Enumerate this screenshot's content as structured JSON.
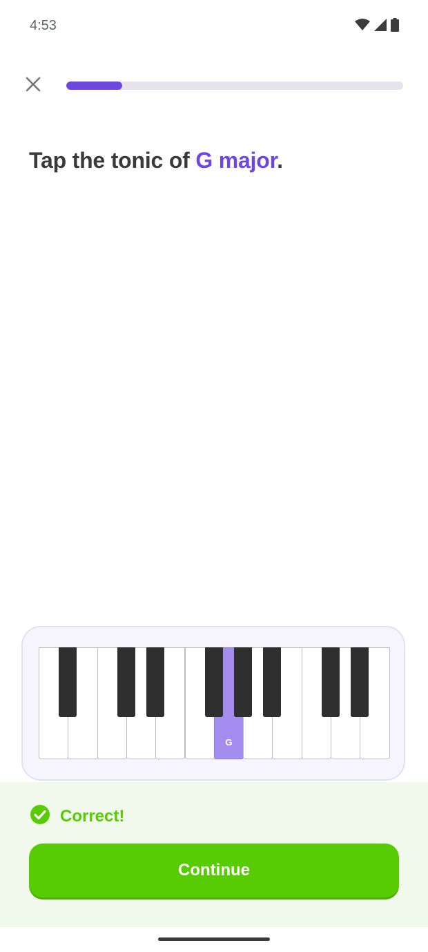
{
  "status_bar": {
    "time": "4:53",
    "icons": [
      "wifi-icon",
      "cell-signal-icon",
      "battery-icon"
    ]
  },
  "header": {
    "close_icon": "close-icon",
    "progress": 0.165
  },
  "question": {
    "prefix": "Tap the tonic of ",
    "highlight": "G major",
    "suffix": "."
  },
  "keyboard": {
    "white_keys": [
      {
        "label": "",
        "active": false
      },
      {
        "label": "",
        "active": false
      },
      {
        "label": "",
        "active": false
      },
      {
        "label": "",
        "active": false
      },
      {
        "label": "",
        "active": false
      },
      {
        "label": "",
        "active": false
      },
      {
        "label": "G",
        "active": true
      },
      {
        "label": "",
        "active": false
      },
      {
        "label": "",
        "active": false
      },
      {
        "label": "",
        "active": false
      },
      {
        "label": "",
        "active": false
      },
      {
        "label": "",
        "active": false
      }
    ],
    "black_keys_after_white": [
      0,
      2,
      3,
      5,
      6,
      7,
      9,
      10
    ]
  },
  "feedback": {
    "icon": "check-circle-icon",
    "message": "Correct!",
    "button_label": "Continue"
  },
  "colors": {
    "accent": "#6c47e0",
    "success": "#58cc02",
    "active_key": "#a38ef0"
  }
}
